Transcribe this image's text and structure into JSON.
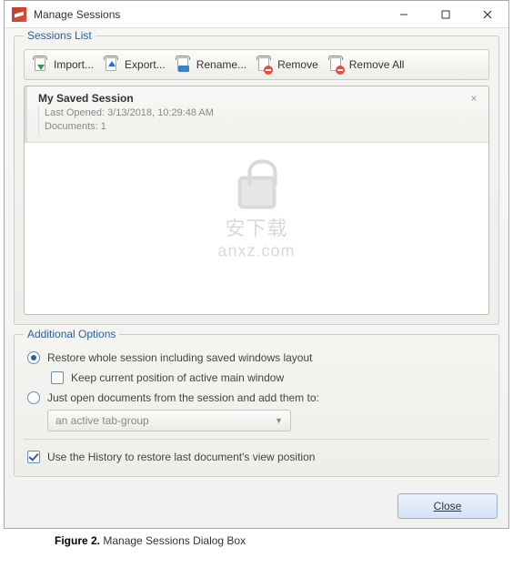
{
  "window": {
    "title": "Manage Sessions"
  },
  "sessions_group": {
    "title": "Sessions List"
  },
  "toolbar": {
    "import": "Import...",
    "export": "Export...",
    "rename": "Rename...",
    "remove": "Remove",
    "remove_all": "Remove All"
  },
  "session": {
    "name": "My Saved Session",
    "last_opened_label": "Last Opened: ",
    "last_opened_value": "3/13/2018, 10:29:48 AM",
    "documents_label": "Documents: ",
    "documents_value": "1"
  },
  "watermark": {
    "cn": "安下载",
    "domain": "anxz.com"
  },
  "options_group": {
    "title": "Additional Options"
  },
  "options": {
    "restore_whole": "Restore whole session including saved windows layout",
    "keep_position": "Keep current position of active main window",
    "just_open": "Just open documents from the session and add them to:",
    "tab_group": "an active tab-group",
    "use_history": "Use the History to restore last document's view position"
  },
  "buttons": {
    "close": "Close"
  },
  "caption": {
    "label": "Figure 2.",
    "text": " Manage Sessions Dialog Box"
  }
}
